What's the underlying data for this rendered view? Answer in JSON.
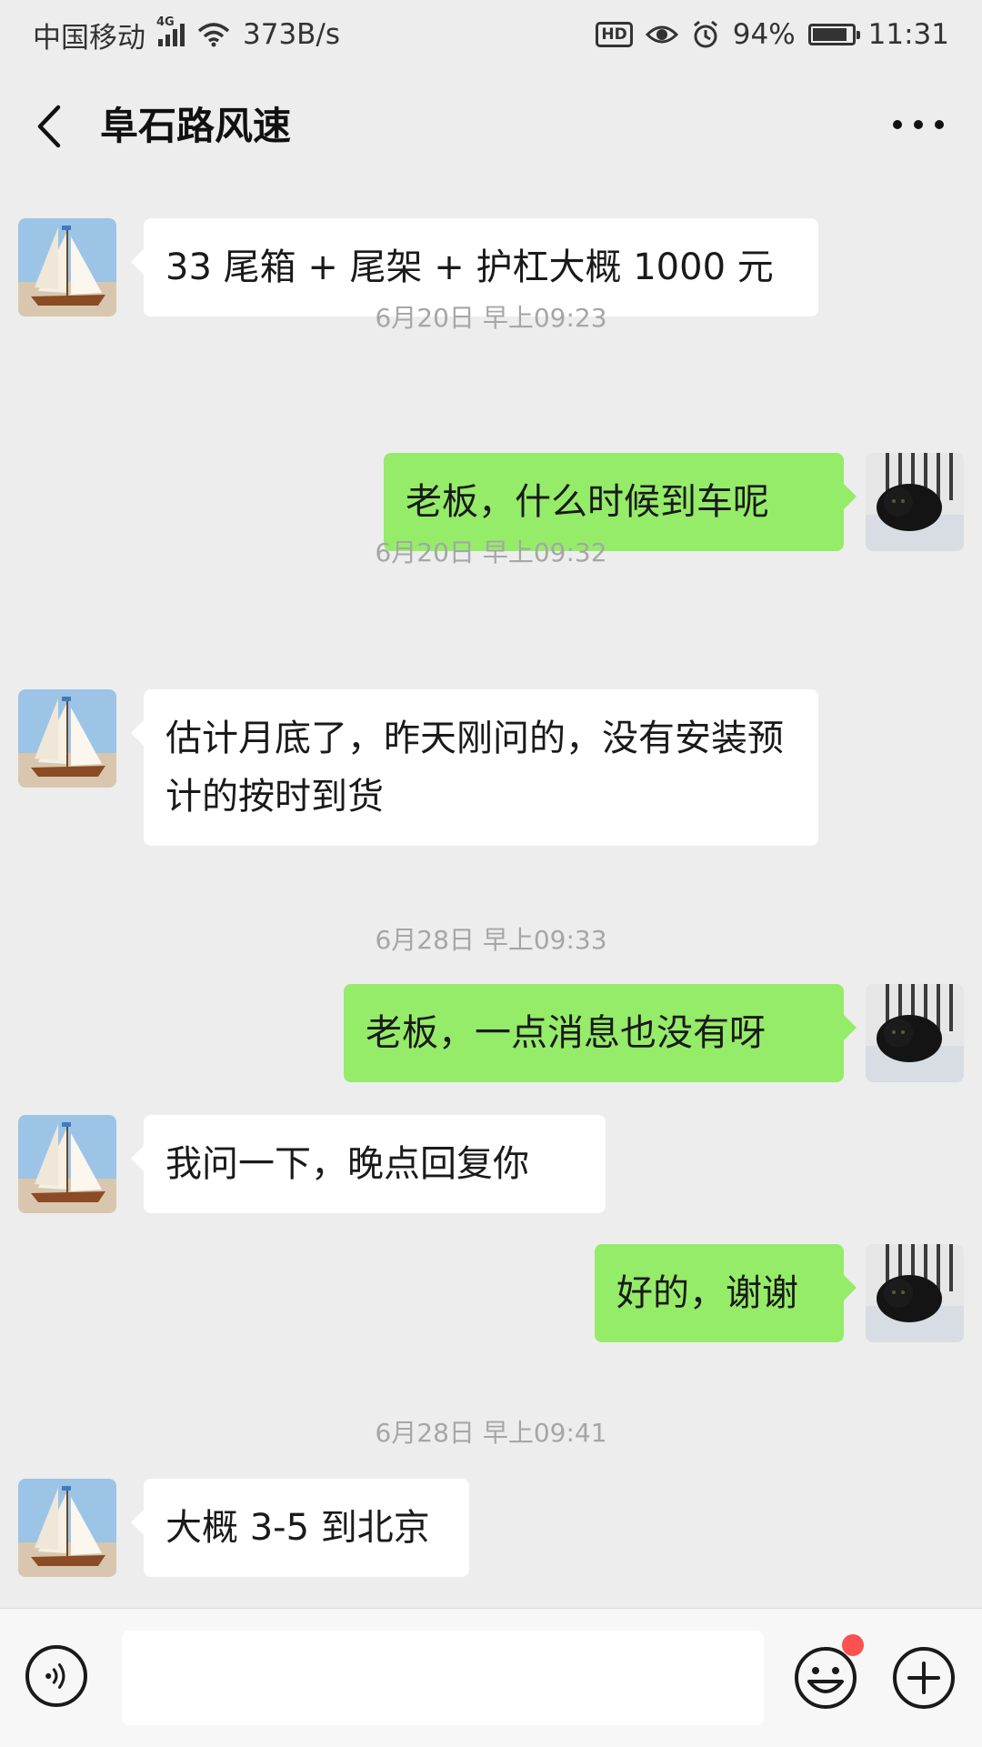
{
  "status_bar": {
    "carrier": "中国移动",
    "network": "4G",
    "speed": "373B/s",
    "hd": "HD",
    "battery": "94%",
    "battery_level": 0.94,
    "time": "11:31"
  },
  "header": {
    "title": "阜石路风速"
  },
  "messages": [
    {
      "type": "in",
      "text": "33 尾箱 + 尾架 + 护杠大概 1000 元",
      "avatar": "sailboat-avatar"
    },
    {
      "type": "timestamp",
      "text": "6月20日 早上09:23"
    },
    {
      "type": "out",
      "text": "老板，什么时候到车呢",
      "avatar": "black-cat-avatar"
    },
    {
      "type": "timestamp",
      "text": "6月20日 早上09:32"
    },
    {
      "type": "in",
      "text": "估计月底了，昨天刚问的，没有安装预计的按时到货",
      "avatar": "sailboat-avatar"
    },
    {
      "type": "timestamp",
      "text": "6月28日 早上09:33"
    },
    {
      "type": "out",
      "text": "老板，一点消息也没有呀",
      "avatar": "black-cat-avatar"
    },
    {
      "type": "in",
      "text": "我问一下，晚点回复你",
      "avatar": "sailboat-avatar"
    },
    {
      "type": "out",
      "text": "好的，谢谢",
      "avatar": "black-cat-avatar"
    },
    {
      "type": "timestamp",
      "text": "6月28日 早上09:41"
    },
    {
      "type": "in",
      "text": "大概 3-5 到北京",
      "avatar": "sailboat-avatar"
    }
  ],
  "input_bar": {
    "text": ""
  },
  "colors": {
    "background": "#ededed",
    "outgoing_bubble": "#95ec69",
    "incoming_bubble": "#ffffff",
    "notification_dot": "#fa5151"
  }
}
